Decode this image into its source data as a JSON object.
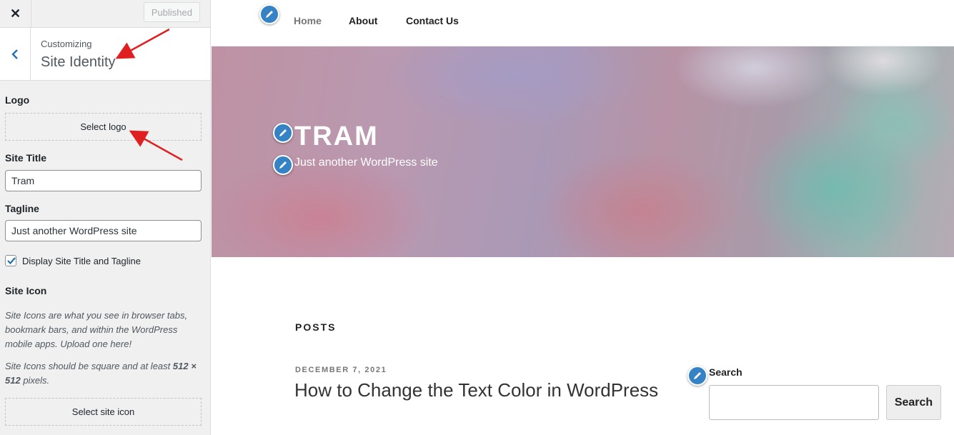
{
  "customizer": {
    "close_icon": "close-icon",
    "publish_label": "Published",
    "back_icon": "chevron-left-icon",
    "breadcrumb": "Customizing",
    "section_title": "Site Identity",
    "logo": {
      "label": "Logo",
      "button_label": "Select logo"
    },
    "site_title": {
      "label": "Site Title",
      "value": "Tram"
    },
    "tagline": {
      "label": "Tagline",
      "value": "Just another WordPress site"
    },
    "display_title_tagline": {
      "label": "Display Site Title and Tagline",
      "checked": true
    },
    "site_icon": {
      "label": "Site Icon",
      "description_1": "Site Icons are what you see in browser tabs, bookmark bars, and within the WordPress mobile apps. Upload one here!",
      "description_2_prefix": "Site Icons should be square and at least ",
      "description_2_bold": "512 × 512",
      "description_2_suffix": " pixels.",
      "button_label": "Select site icon"
    }
  },
  "preview": {
    "nav": {
      "items": [
        "Home",
        "About",
        "Contact Us"
      ],
      "active": "Home"
    },
    "site_title": "TRAM",
    "site_tagline": "Just another WordPress site",
    "posts_heading": "POSTS",
    "post": {
      "date": "DECEMBER 7, 2021",
      "title": "How to Change the Text Color in WordPress"
    },
    "search_widget": {
      "label": "Search",
      "button_label": "Search",
      "value": ""
    },
    "edit_shortcut_icon": "pencil-icon"
  },
  "colors": {
    "wp_blue": "#2271b1",
    "edit_shortcut": "#3582c4",
    "annotation_arrow": "#e02020"
  }
}
